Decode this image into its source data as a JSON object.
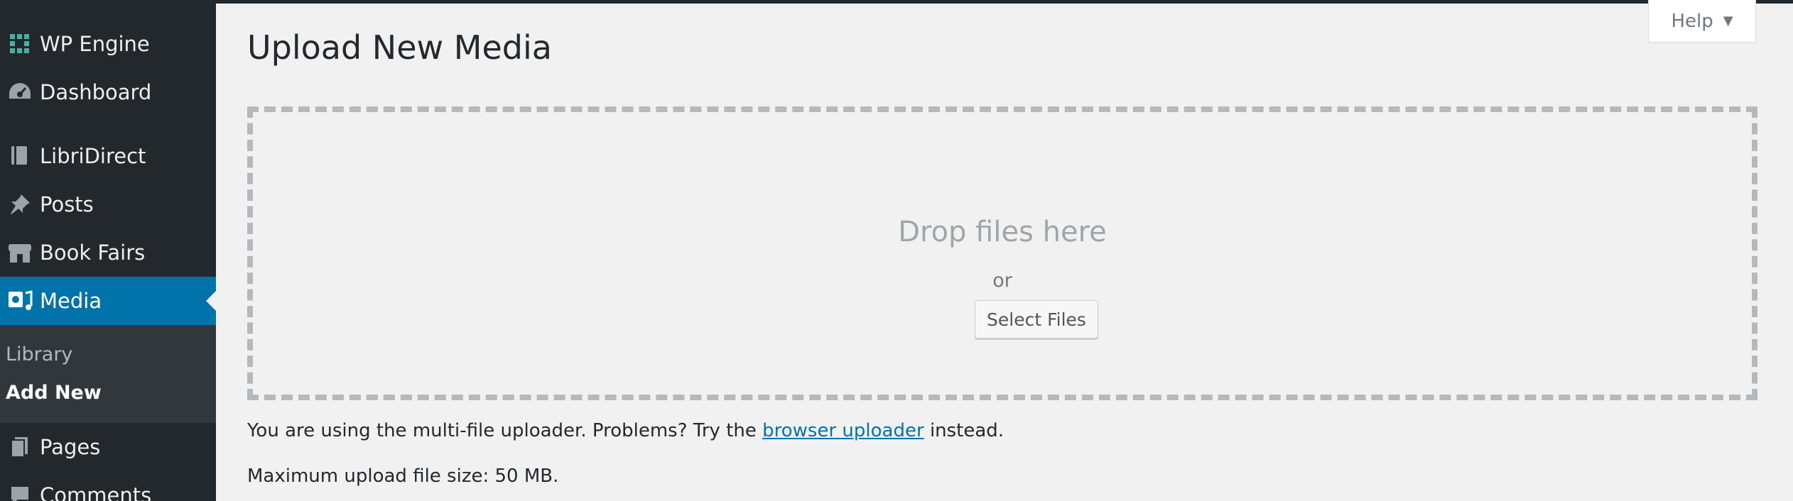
{
  "sidebar": {
    "items": [
      {
        "label": "WP Engine",
        "icon": "grid-icon"
      },
      {
        "label": "Dashboard",
        "icon": "gauge-icon"
      },
      {
        "label": "LibriDirect",
        "icon": "book-icon"
      },
      {
        "label": "Posts",
        "icon": "pushpin-icon"
      },
      {
        "label": "Book Fairs",
        "icon": "store-icon"
      },
      {
        "label": "Media",
        "icon": "media-icon",
        "active": true
      },
      {
        "label": "Pages",
        "icon": "page-icon"
      },
      {
        "label": "Comments",
        "icon": "comment-icon"
      }
    ],
    "submenu": [
      {
        "label": "Library"
      },
      {
        "label": "Add New",
        "current": true
      }
    ]
  },
  "help": {
    "label": "Help",
    "caret": "▼"
  },
  "page": {
    "title": "Upload New Media"
  },
  "uploader": {
    "drop_text": "Drop files here",
    "or_text": "or",
    "select_files_label": "Select Files",
    "note_prefix": "You are using the multi-file uploader. Problems? Try the",
    "note_link": "browser uploader",
    "note_suffix": "instead.",
    "max_size": "Maximum upload file size: 50 MB."
  },
  "colors": {
    "sidebar_bg": "#23282d",
    "accent": "#0073aa",
    "page_bg": "#f1f1f1"
  }
}
